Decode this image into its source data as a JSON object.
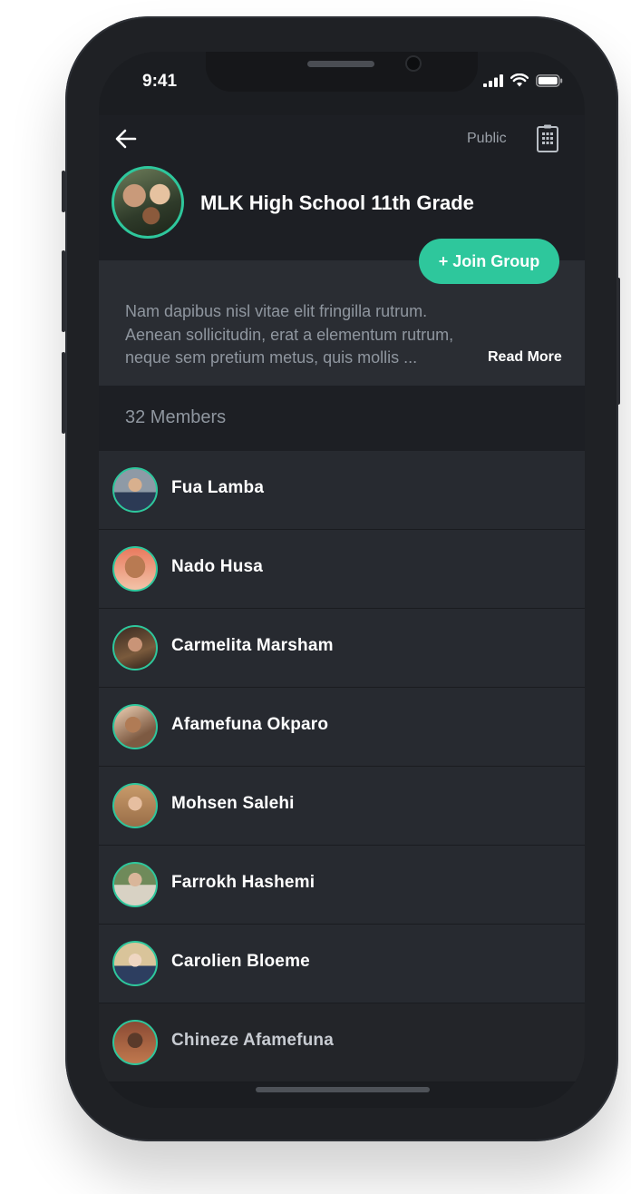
{
  "status_bar": {
    "time": "9:41",
    "icons": [
      "signal-icon",
      "wifi-icon",
      "battery-icon"
    ]
  },
  "header": {
    "visibility": "Public",
    "title": "MLK High School 11th Grade",
    "join_label": "+ Join Group"
  },
  "description": {
    "lines": [
      "Nam dapibus nisl vitae elit fringilla rutrum.",
      "Aenean sollicitudin, erat a elementum rutrum,",
      "neque sem pretium metus, quis mollis ..."
    ],
    "read_more": "Read More"
  },
  "members": {
    "count_label": "32 Members",
    "list": [
      {
        "name": "Fua Lamba"
      },
      {
        "name": "Nado Husa"
      },
      {
        "name": "Carmelita Marsham"
      },
      {
        "name": "Afamefuna Okparo"
      },
      {
        "name": "Mohsen Salehi"
      },
      {
        "name": "Farrokh Hashemi"
      },
      {
        "name": "Carolien Bloeme"
      },
      {
        "name": "Chineze Afamefuna"
      }
    ]
  },
  "colors": {
    "accent": "#2ec79c",
    "background": "#1b1d21",
    "row": "#272a30"
  }
}
